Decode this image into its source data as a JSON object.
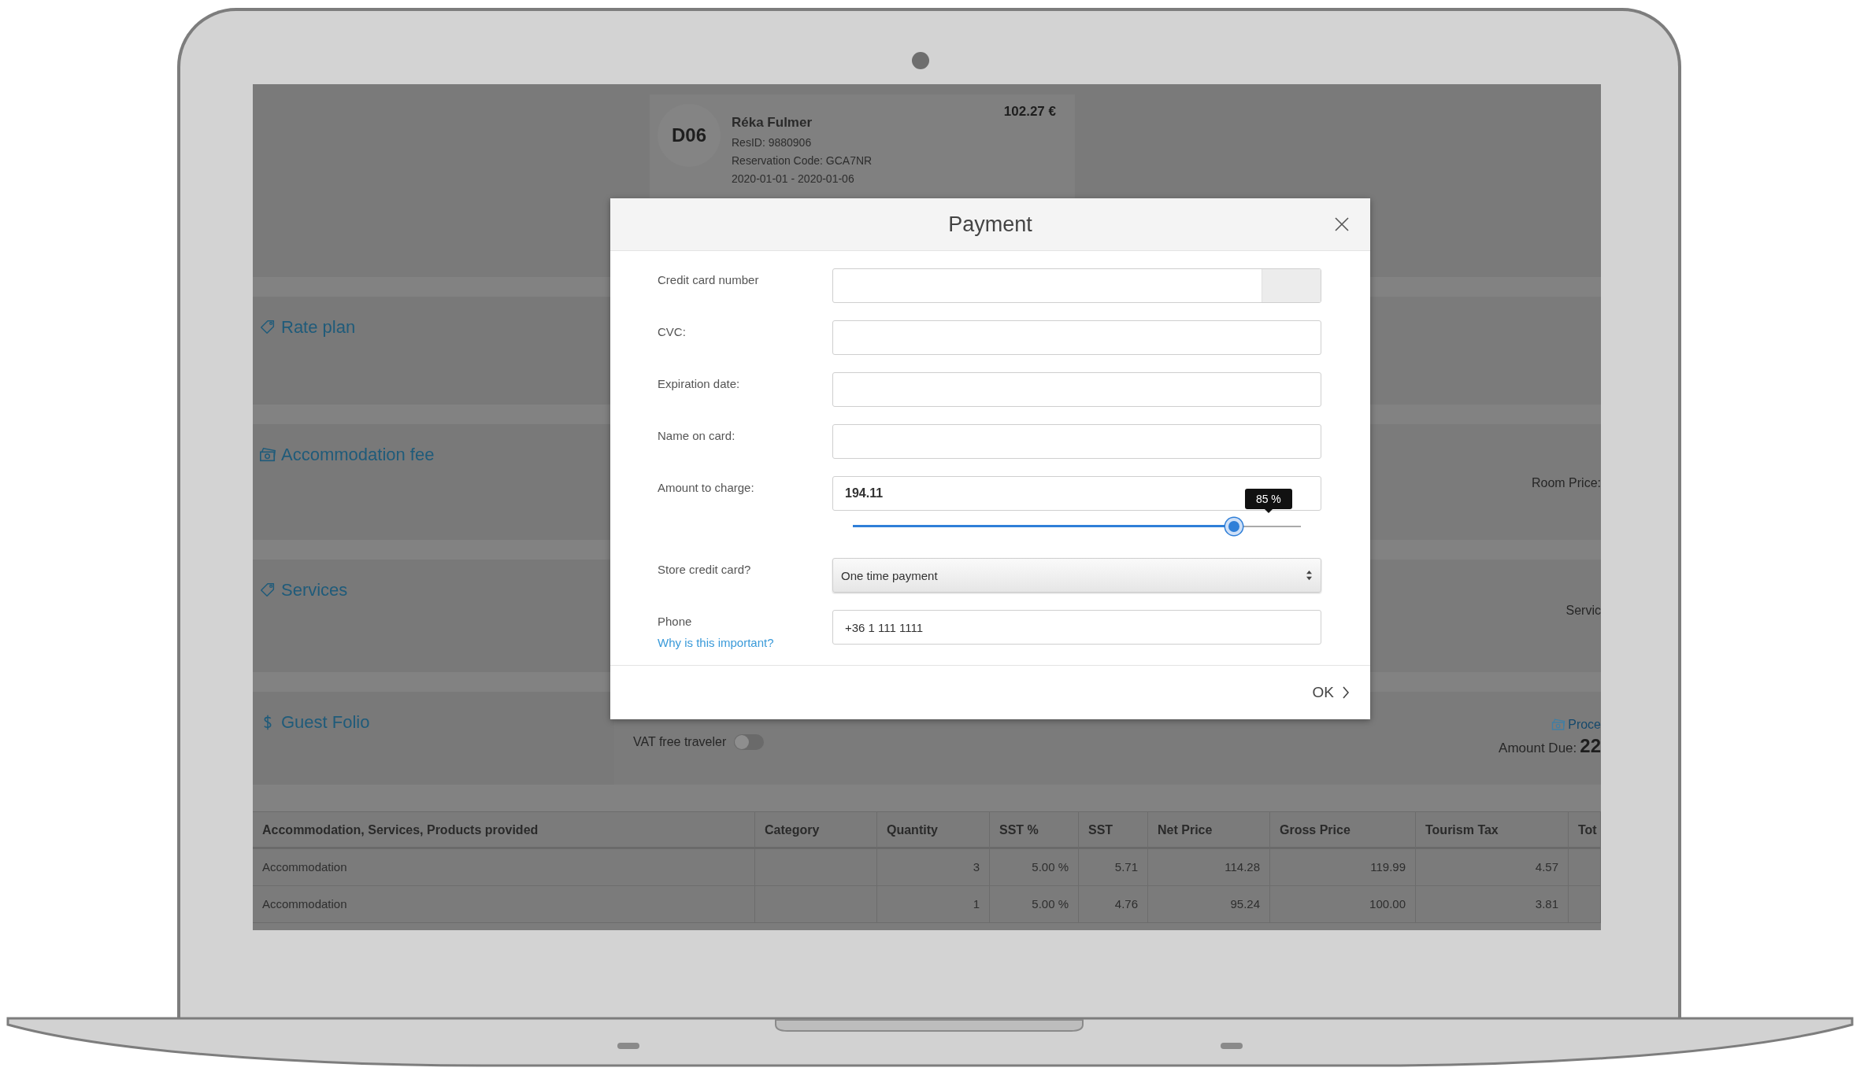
{
  "reservation_card": {
    "room": "D06",
    "guest": "Réka Fulmer",
    "res_id": "ResID: 9880906",
    "reservation_code": "Reservation Code: GCA7NR",
    "dates": "2020-01-01 - 2020-01-06",
    "price": "102.27 €"
  },
  "sections": [
    {
      "title": "Rate plan"
    },
    {
      "title": "Accommodation fee",
      "right_text": "Room Price:"
    },
    {
      "title": "Services",
      "right_text": "Servic"
    },
    {
      "title": "Guest Folio"
    }
  ],
  "guest_folio": {
    "vat_toggle": {
      "label": "VAT free traveler",
      "on": false
    },
    "process_link": "Proce",
    "amount_due_label": "Amount Due:",
    "amount_due_value": "22"
  },
  "table": {
    "columns": [
      "Accommodation, Services, Products provided",
      "Category",
      "Quantity",
      "SST %",
      "SST",
      "Net Price",
      "Gross Price",
      "Tourism Tax",
      "Tot"
    ],
    "rows": [
      [
        "Accommodation",
        "",
        "3",
        "5.00 %",
        "5.71",
        "114.28",
        "119.99",
        "4.57",
        ""
      ],
      [
        "Accommodation",
        "",
        "1",
        "5.00 %",
        "4.76",
        "95.24",
        "100.00",
        "3.81",
        ""
      ]
    ]
  },
  "modal": {
    "title": "Payment",
    "fields": [
      {
        "kind": "card",
        "label": "Credit card number"
      },
      {
        "kind": "text",
        "label": "CVC:"
      },
      {
        "kind": "text",
        "label": "Expiration date:"
      },
      {
        "kind": "text",
        "label": "Name on card:"
      },
      {
        "kind": "amount",
        "label": "Amount to charge:",
        "value": "194.11",
        "level": 0.85,
        "tooltip": "85 %"
      },
      {
        "kind": "select",
        "label": "Store credit card?",
        "value": "One time payment"
      },
      {
        "kind": "phone",
        "label": "Phone",
        "link": "Why is this important?",
        "value": "+36 1 111 1111"
      }
    ],
    "ok_button": "OK"
  }
}
